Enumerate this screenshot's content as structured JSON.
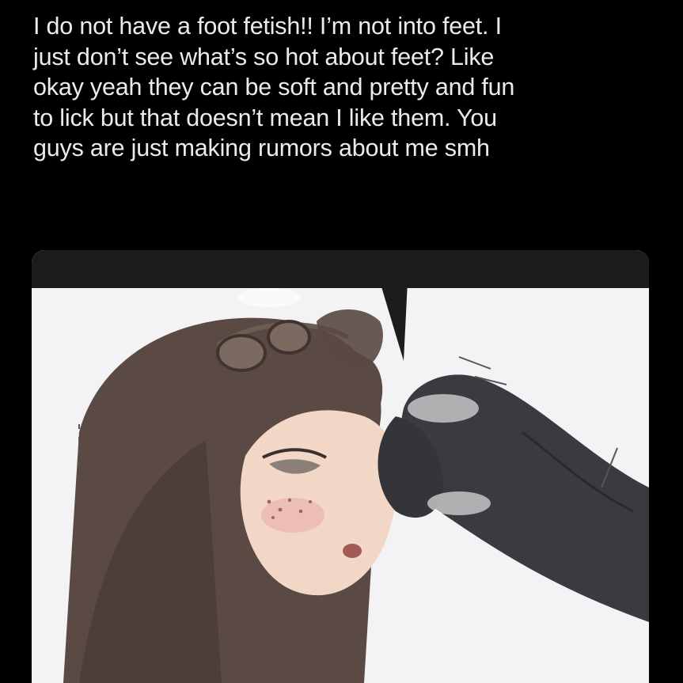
{
  "post": {
    "text_lines": [
      "I do not have a foot fetish!! I’m not into feet. I",
      "just don’t see what’s so hot about feet? Like",
      "okay yeah they can be soft and pretty and fun",
      "to lick but that doesn’t mean I like them. You",
      "guys are just making rumors about me smh"
    ]
  },
  "media": {
    "icon": "anime-illustration",
    "colors": {
      "background": "#000000",
      "text": "#ebebeb",
      "panel_top_band": "#1c1b1d",
      "panel_bg": "#f3f2f4",
      "hair": "#5b4a43",
      "skin": "#f2d7c6",
      "sock": "#3b3a3f"
    }
  }
}
